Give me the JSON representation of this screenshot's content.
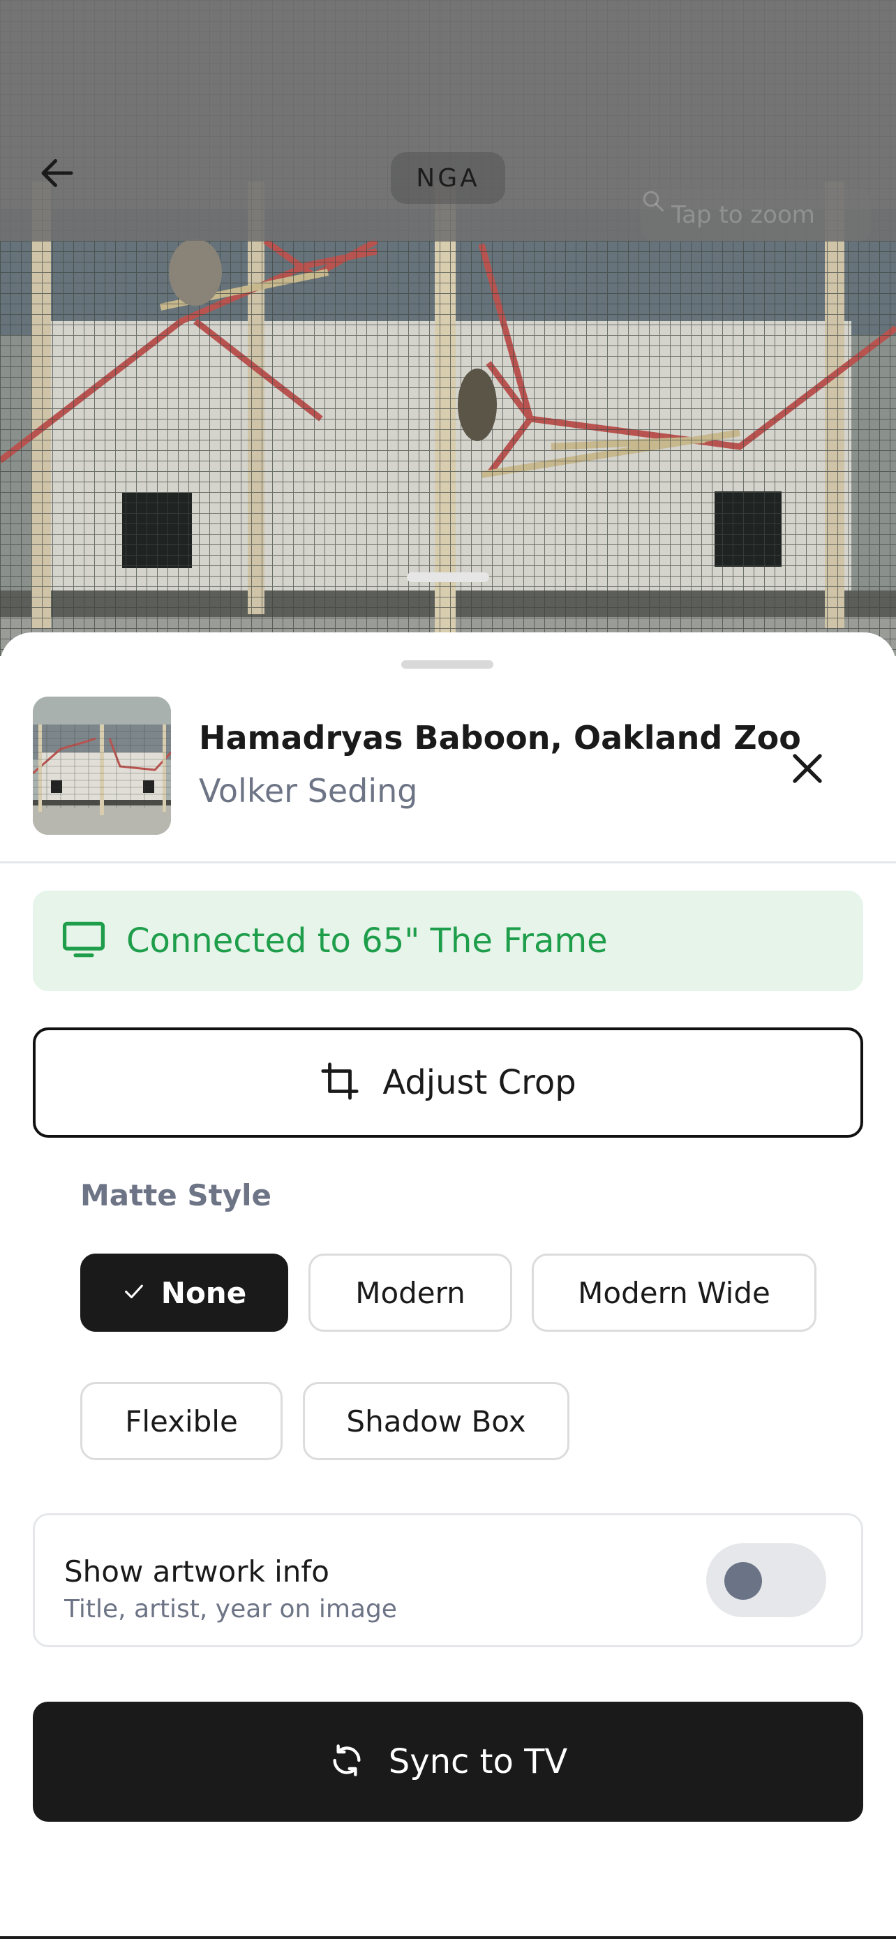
{
  "header": {
    "source_label": "NGA",
    "zoom_hint": "Tap to zoom"
  },
  "artwork": {
    "title": "Hamadryas Baboon, Oakland Zoo",
    "artist": "Volker Seding"
  },
  "connection": {
    "label": "Connected to 65\" The Frame",
    "color": "#1e9e4a",
    "background": "#e6f4ea"
  },
  "actions": {
    "adjust_crop_label": "Adjust Crop",
    "sync_label": "Sync to TV"
  },
  "matte": {
    "heading": "Matte Style",
    "selected": "None",
    "options": [
      "None",
      "Modern",
      "Modern Wide",
      "Flexible",
      "Shadow Box"
    ]
  },
  "artwork_info": {
    "title": "Show artwork info",
    "subtitle": "Title, artist, year on image",
    "enabled": false
  },
  "icons": {
    "back": "arrow-left-icon",
    "search": "search-icon",
    "close": "close-icon",
    "tv": "tv-icon",
    "crop": "crop-icon",
    "check": "check-icon",
    "sync": "sync-icon"
  },
  "colors": {
    "primary": "#1a1a1a",
    "muted_text": "#6d7485"
  }
}
